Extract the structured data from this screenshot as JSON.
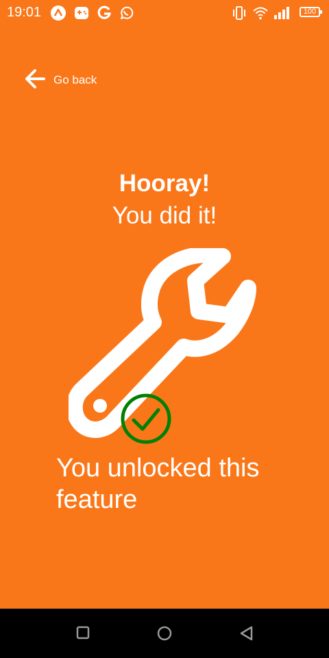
{
  "status_bar": {
    "time": "19:01",
    "battery": "100",
    "notification_icons": [
      "assistant-icon",
      "game-controller-icon",
      "google-icon",
      "whatsapp-icon"
    ],
    "system_icons": [
      "vibrate-icon",
      "wifi-icon",
      "signal-icon",
      "battery-icon"
    ]
  },
  "header": {
    "back_label": "Go back",
    "back_icon": "arrow-left-icon"
  },
  "main": {
    "headline": "Hooray!",
    "subheadline": "You did it!",
    "illustration_icon": "wrench-icon",
    "check_icon": "check-circle-icon",
    "message": "You unlocked this feature"
  },
  "nav_bar": {
    "buttons": [
      "recents-square-icon",
      "home-circle-icon",
      "back-triangle-icon"
    ]
  },
  "colors": {
    "background": "#fa7719",
    "check": "#008000",
    "text": "#ffffff",
    "nav_bar": "#000000"
  }
}
